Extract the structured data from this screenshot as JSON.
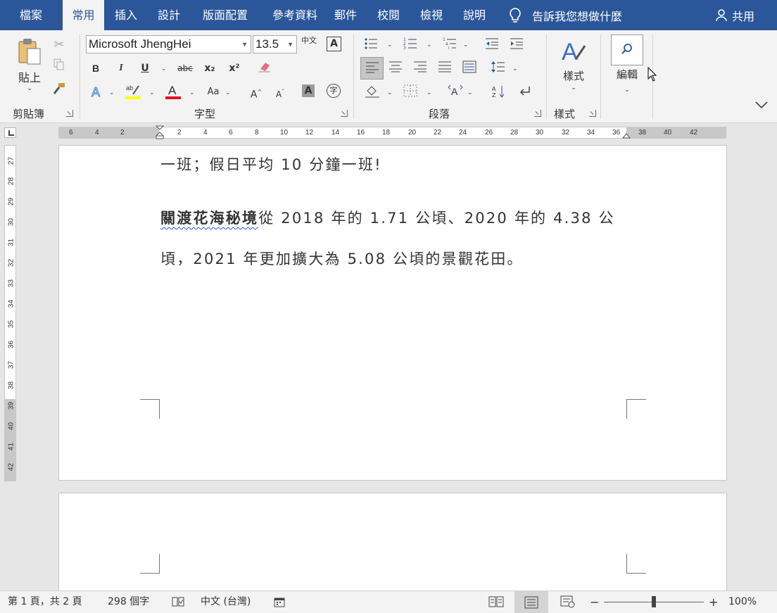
{
  "menu": {
    "tabs": [
      "檔案",
      "常用",
      "插入",
      "設計",
      "版面配置",
      "參考資料",
      "郵件",
      "校閱",
      "檢視",
      "說明"
    ],
    "active_tab": "常用",
    "tell_me": "告訴我您想做什麼",
    "share": "共用"
  },
  "ribbon": {
    "clipboard": {
      "paste_label": "貼上",
      "group_label": "剪貼簿"
    },
    "font": {
      "font_name": "Microsoft JhengHei",
      "font_size": "13.5",
      "group_label": "字型",
      "bold": "B",
      "italic": "I",
      "underline": "U",
      "strike": "abc",
      "subscript": "x₂",
      "superscript": "x²",
      "grow_font": "A",
      "shrink_font": "A",
      "change_case": "Aa",
      "phonetic": "中文",
      "char_border": "A",
      "char_shading": "A",
      "enclose": "字"
    },
    "paragraph": {
      "group_label": "段落"
    },
    "styles": {
      "label": "樣式",
      "group_label": "樣式"
    },
    "editing": {
      "label": "編輯"
    },
    "colors": {
      "brand": "#2b579a",
      "highlight": "#ffff00",
      "font_color": "#e0161f"
    }
  },
  "rulers": {
    "horizontal_ticks": [
      "6",
      "4",
      "2",
      "2",
      "4",
      "6",
      "8",
      "10",
      "12",
      "14",
      "16",
      "18",
      "20",
      "22",
      "24",
      "26",
      "28",
      "30",
      "32",
      "34",
      "36",
      "38",
      "40",
      "42"
    ],
    "vertical_ticks": [
      "27",
      "28",
      "29",
      "30",
      "31",
      "32",
      "33",
      "34",
      "35",
      "36",
      "37",
      "38",
      "39",
      "40",
      "41",
      "42"
    ]
  },
  "document": {
    "line1": "一班；假日平均 10 分鐘一班!",
    "line2_bold": "關渡花海秘境",
    "line2_rest": "從 2018 年的 1.71 公頃、2020 年的 4.38 公",
    "line3": "頃，2021 年更加擴大為 5.08 公頃的景觀花田。"
  },
  "status": {
    "page_info": "第 1 頁，共 2 頁",
    "word_count": "298 個字",
    "language": "中文 (台灣)",
    "zoom_minus": "−",
    "zoom_plus": "+",
    "zoom": "100%"
  }
}
